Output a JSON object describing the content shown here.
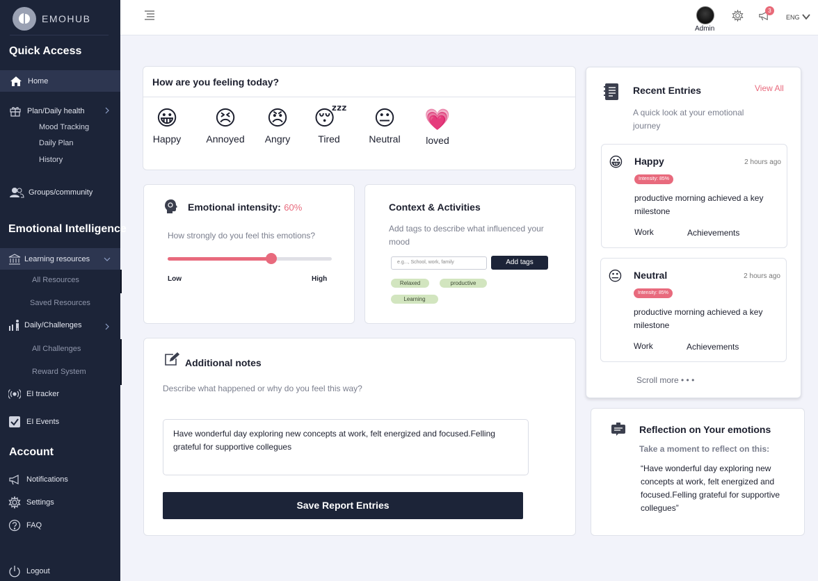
{
  "brand": {
    "name": "EMOHUB"
  },
  "sidebar": {
    "quick_access_title": "Quick Access",
    "home": "Home",
    "plan": "Plan/Daily health",
    "plan_sub": [
      "Mood Tracking",
      "Daily Plan",
      "History"
    ],
    "groups": "Groups/community",
    "ei_title": "Emotional Intelligence",
    "learning": "Learning resources",
    "learning_sub": [
      "All Resources",
      "Saved Resources"
    ],
    "challenges": "Daily/Challenges",
    "challenges_sub": [
      "All Challenges",
      "Reward System"
    ],
    "ei_tracker": "EI tracker",
    "ei_events": "EI Events",
    "account_title": "Account",
    "notifications": "Notifications",
    "settings": "Settings",
    "faq": "FAQ",
    "logout": "Logout"
  },
  "topbar": {
    "user": "Admin",
    "notification_count": "3",
    "language": "ENG"
  },
  "feeling": {
    "title": "How are you feeling today?",
    "moods": [
      {
        "emoji": "😀",
        "label": "Happy"
      },
      {
        "emoji": "😣",
        "label": "Annoyed"
      },
      {
        "emoji": "😠",
        "label": "Angry"
      },
      {
        "emoji": "😴",
        "label": "Tired"
      },
      {
        "emoji": "😐",
        "label": "Neutral"
      },
      {
        "emoji": "💗",
        "label": "loved"
      }
    ]
  },
  "intensity": {
    "title": "Emotional intensity:",
    "value_text": "60%",
    "value": 0.63,
    "question": "How strongly do you feel this emotions?",
    "low": "Low",
    "high": "High"
  },
  "context": {
    "title": "Context & Activities",
    "desc": "Add tags to describe what influenced your mood",
    "placeholder": "e.g..., School, work, family",
    "button": "Add tags",
    "tags": [
      "Relaxed",
      "productive",
      "Learning"
    ]
  },
  "notes": {
    "title": "Additional notes",
    "prompt": "Describe what happened or why do you feel this way?",
    "text": "Have wonderful day exploring new concepts at work, felt energized and focused.Felling grateful for supportive collegues",
    "save_button": "Save Report Entries"
  },
  "recent": {
    "title": "Recent Entries",
    "view_all": "View All",
    "subtitle": "A quick look at your emotional journey",
    "entries": [
      {
        "emoji": "😀",
        "name": "Happy",
        "time": "2 hours ago",
        "intensity": "Intensity: 85%",
        "desc": "productive morning achieved a key milestone",
        "tag1": "Work",
        "tag2": "Achievements"
      },
      {
        "emoji": "😐",
        "name": "Neutral",
        "time": "2 hours ago",
        "intensity": "Intensity: 85%",
        "desc": "productive morning achieved a key milestone",
        "tag1": "Work",
        "tag2": "Achievements"
      }
    ],
    "scroll_more": "Scroll more • • •"
  },
  "reflection": {
    "title": "Reflection on Your emotions",
    "subtitle": "Take a moment to reflect on this:",
    "quote": "“Have wonderful day exploring new concepts at work, felt energized and focused.Felling grateful for supportive collegues”"
  }
}
